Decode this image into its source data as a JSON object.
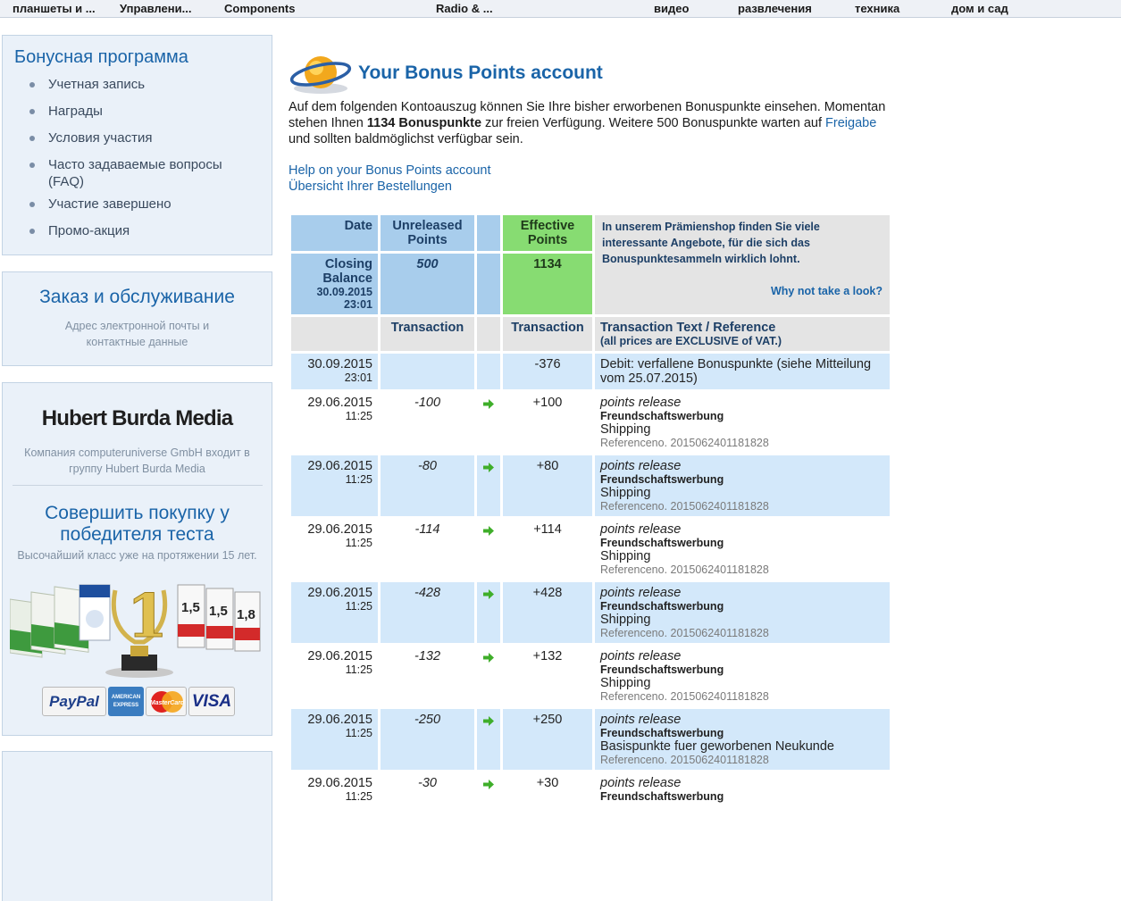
{
  "nav": [
    "планшеты и ...",
    "Управлени...",
    "Components",
    "Radio & ...",
    "видео",
    "развлечения",
    "техника",
    "дом и сад"
  ],
  "sidebar": {
    "bonus_title": "Бонусная программа",
    "bonus_items": [
      "Учетная запись",
      "Награды",
      "Условия участия",
      "Часто задаваемые вопросы (FAQ)",
      "Участие завершено",
      "Промо-акция"
    ],
    "order_title": "Заказ и обслуживание",
    "order_text": "Адрес электронной почты и контактные данные",
    "burda_logo": "Hubert Burda Media",
    "burda_text": "Компания computeruniverse GmbH входит в группу Hubert Burda Media",
    "winner_title": "Совершить покупку у победителя теста",
    "winner_sub": "Высочайший класс уже на протяжении 15 лет.",
    "payments": [
      "PayPal",
      "AMERICAN EXPRESS",
      "MasterCard",
      "VISA"
    ]
  },
  "main": {
    "title": "Your Bonus Points account",
    "intro_1": "Auf dem folgenden Kontoauszug können Sie Ihre bisher erworbenen Bonuspunkte einsehen. Momentan stehen Ihnen ",
    "intro_bold": "1134 Bonuspunkte",
    "intro_2": " zur freien Verfügung. Weitere 500 Bonuspunkte warten auf ",
    "intro_link": "Freigabe",
    "intro_3": " und sollten baldmöglichst verfügbar sein.",
    "help_link": "Help on your Bonus Points account",
    "orders_link": "Übersicht Ihrer Bestellungen"
  },
  "table": {
    "hdr_date": "Date",
    "hdr_unreleased": "Unreleased Points",
    "hdr_effective": "Effective Points",
    "promo_text": "In unserem Prämienshop finden Sie viele interessante Angebote, für die sich das Bonuspunktesammeln wirklich lohnt.",
    "promo_link": "Why not take a look?",
    "closing_label": "Closing Balance",
    "closing_date": "30.09.2015",
    "closing_time": "23:01",
    "closing_unreleased": "500",
    "closing_effective": "1134",
    "sub_transaction": "Transaction",
    "sub_transaction2": "Transaction",
    "sub_text": "Transaction Text / Reference",
    "sub_vat": "(all prices are EXCLUSIVE of VAT.)",
    "rows": [
      {
        "date": "30.09.2015",
        "time": "23:01",
        "unreleased": "",
        "effective": "-376",
        "debit": "Debit: verfallene Bonuspunkte (siehe Mitteilung vom 25.07.2015)"
      },
      {
        "date": "29.06.2015",
        "time": "11:25",
        "unreleased": "-100",
        "effective": "+100",
        "t1": "points release",
        "t2": "Freundschaftswerbung",
        "t3": "Shipping",
        "t4": "Referenceno. 2015062401181828"
      },
      {
        "date": "29.06.2015",
        "time": "11:25",
        "unreleased": "-80",
        "effective": "+80",
        "t1": "points release",
        "t2": "Freundschaftswerbung",
        "t3": "Shipping",
        "t4": "Referenceno. 2015062401181828"
      },
      {
        "date": "29.06.2015",
        "time": "11:25",
        "unreleased": "-114",
        "effective": "+114",
        "t1": "points release",
        "t2": "Freundschaftswerbung",
        "t3": "Shipping",
        "t4": "Referenceno. 2015062401181828"
      },
      {
        "date": "29.06.2015",
        "time": "11:25",
        "unreleased": "-428",
        "effective": "+428",
        "t1": "points release",
        "t2": "Freundschaftswerbung",
        "t3": "Shipping",
        "t4": "Referenceno. 2015062401181828"
      },
      {
        "date": "29.06.2015",
        "time": "11:25",
        "unreleased": "-132",
        "effective": "+132",
        "t1": "points release",
        "t2": "Freundschaftswerbung",
        "t3": "Shipping",
        "t4": "Referenceno. 2015062401181828"
      },
      {
        "date": "29.06.2015",
        "time": "11:25",
        "unreleased": "-250",
        "effective": "+250",
        "t1": "points release",
        "t2": "Freundschaftswerbung",
        "t3": "Basispunkte fuer geworbenen Neukunde",
        "t4": "Referenceno. 2015062401181828"
      },
      {
        "date": "29.06.2015",
        "time": "11:25",
        "unreleased": "-30",
        "effective": "+30",
        "t1": "points release",
        "t2": "Freundschaftswerbung",
        "t3": "",
        "t4": ""
      }
    ]
  },
  "colors": {
    "accent": "#1a64a8",
    "header_blue": "#a8cdec",
    "header_green": "#87dc72",
    "row_alt": "#d3e8fa",
    "arrow_green": "#3fae2a"
  }
}
